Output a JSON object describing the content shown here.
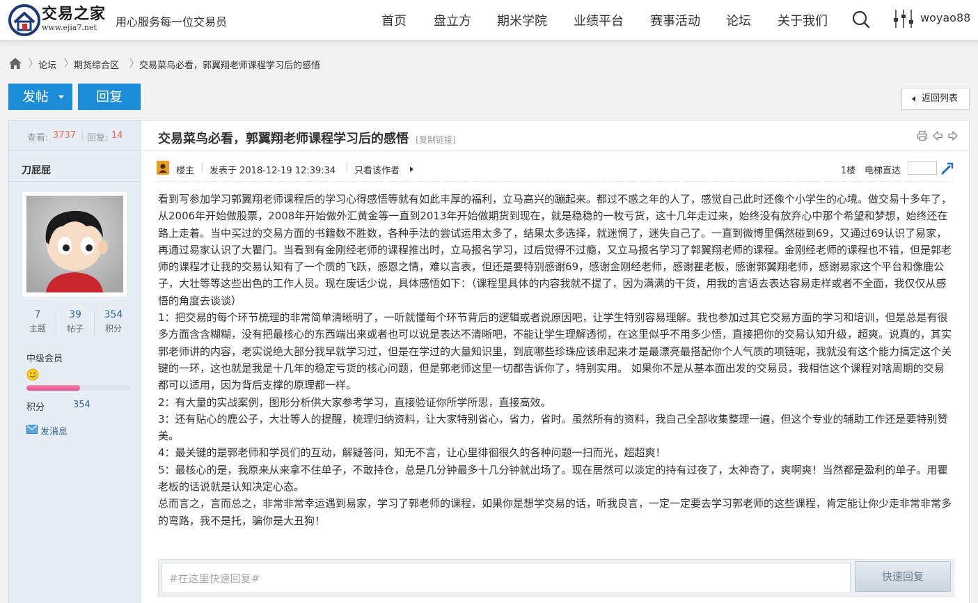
{
  "header": {
    "logo_cn": "交易之家",
    "logo_url": "www.ejia7.net",
    "slogan": "用心服务每一位交易员",
    "nav": [
      "首页",
      "盘立方",
      "期米学院",
      "业绩平台",
      "赛事活动",
      "论坛",
      "关于我们"
    ],
    "username": "woyao88"
  },
  "breadcrumb": {
    "items": [
      "论坛",
      "期货综合区",
      "交易菜鸟必看，郭翼翔老师课程学习后的感悟"
    ]
  },
  "actions": {
    "post_label": "发帖",
    "reply_label": "回复",
    "back_label": "返回列表"
  },
  "sidebar": {
    "views_label": "查看:",
    "views": "3737",
    "replies_label": "回复:",
    "replies": "14",
    "author": "刀屁屁",
    "stats": [
      {
        "num": "7",
        "label": "主题"
      },
      {
        "num": "39",
        "label": "帖子"
      },
      {
        "num": "354",
        "label": "积分"
      }
    ],
    "member_level": "中级会员",
    "level_progress": 0.51,
    "points_label": "积分",
    "points_value": "354",
    "send_msg": "发消息"
  },
  "post": {
    "title": "交易菜鸟必看，郭翼翔老师课程学习后的感悟",
    "copy_link": "[复制链接]",
    "role": "楼主",
    "posted": "发表于 2018-12-19 12:39:34",
    "only_author": "只看该作者",
    "floor": "1楼",
    "elevator": "电梯直达",
    "paragraphs": [
      "看到写参加学习郭翼翔老师课程后的学习心得感悟等就有如此丰厚的福利，立马高兴的蹦起来。都过不惑之年的人了，感觉自己此时还像个小学生的心境。做交易十多年了，从2006年开始做股票，2008年开始做外汇黄金等一直到2013年开始做期货到现在，就是稳稳的一枚亏货，这十几年走过来，始终没有放弃心中那个希望和梦想，始终还在路上走着。当中买过的交易方面的书籍数不胜数，各种手法的尝试运用太多了，结果太多选择，就迷惘了，迷失自己了。一直到微博里偶然碰到69，又通过69认识了易家，再通过易家认识了大瞿门。当看到有金刚经老师的课程推出时，立马报名学习，过后觉得不过瘾，又立马报名学习了郭翼翔老师的课程。金刚经老师的课程也不错，但是郭老师的课程才让我的交易认知有了一个质的飞跃，感恩之情，难以言表，但还是要特别感谢69，感谢金刚经老师，感谢瞿老板，感谢郭翼翔老师，感谢易家这个平台和像鹿公子，大壮等等这些出色的工作人员。现在废话少说，具体感悟如下：（课程里具体的内容我就不提了，因为满满的干货，用我的言语去表达容易走样或者不全面，我仅仅从感悟的角度去谈谈）",
      "1：把交易的每个环节梳理的非常简单清晰明了，一听就懂每个环节背后的逻辑或者说原因吧，让学生特别容易理解。我也参加过其它交易方面的学习和培训，但是总是有很多方面含含糊糊，没有把最核心的东西端出来或者也可以说是表达不清晰吧，不能让学生理解透彻，在这里似乎不用多少悟，直接把你的交易认知升级，超爽。说真的，其实郭老师讲的内容，老实说绝大部分我早就学习过，但是在学过的大量知识里，到底哪些珍珠应该串起来才是最漂亮最搭配你个人气质的项链呢，我就没有这个能力搞定这个关键的一环，这也就是我是十几年的稳定亏货的核心问题，但是郭老师这里一切都告诉你了，特别实用。 如果你不是从基本面出发的交易员，我相信这个课程对啥周期的交易都可以适用，因为背后支撑的原理都一样。",
      "2：有大量的实战案例，图形分析供大家参考学习，直接验证你所学所思，直接高效。",
      "3：还有贴心的鹿公子，大壮等人的提醒，梳理归纳资料，让大家特别省心，省力，省时。虽然所有的资料，我自己全部收集整理一遍，但这个专业的辅助工作还是要特别赞美。",
      "4：最关键的是郭老师和学员们的互动，解疑答问，知无不言，让心里徘徊很久的各种问题一扫而光，超超爽！",
      "5：最核心的是，我原来从来拿不住单子，不敢持仓，总是几分钟最多十几分钟就出场了。现在居然可以淡定的持有过夜了，太神奇了，爽啊爽！当然都是盈利的单子。用瞿老板的话说就是认知决定心态。",
      "总而言之，言而总之，非常非常幸运遇到易家，学习了郭老师的课程，如果你是想学交易的话，听我良言，一定一定要去学习郭老师的这些课程，肯定能让你少走非常非常多的弯路，我不是托，骗你是大丑狗！"
    ]
  },
  "quick_reply": {
    "placeholder": "#在这里快速回复#",
    "button": "快速回复"
  },
  "icons": {
    "logo": "house-logo-icon",
    "search": "search-icon",
    "user": "user-menu-icon",
    "home": "home-icon",
    "print": "print-icon",
    "prev": "prev-thread-icon",
    "next": "next-thread-icon",
    "author": "author-badge-icon",
    "go": "floor-go-icon",
    "mail": "mail-icon",
    "level": "smiley-level-icon"
  },
  "colors": {
    "accent": "#1a8cd8",
    "sidebar_bg": "#e6eef4",
    "count": "#f26c4f",
    "link": "#336699"
  }
}
